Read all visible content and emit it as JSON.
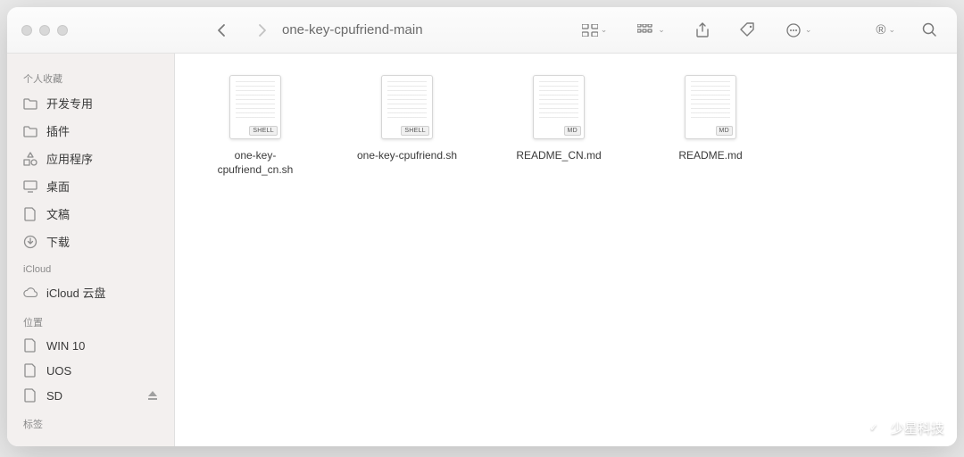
{
  "window": {
    "title": "one-key-cpufriend-main"
  },
  "sidebar": {
    "sections": [
      {
        "title": "个人收藏",
        "items": [
          {
            "icon": "folder",
            "label": "开发专用"
          },
          {
            "icon": "folder",
            "label": "插件"
          },
          {
            "icon": "apps",
            "label": "应用程序"
          },
          {
            "icon": "desktop",
            "label": "桌面"
          },
          {
            "icon": "doc",
            "label": "文稿"
          },
          {
            "icon": "download",
            "label": "下载"
          }
        ]
      },
      {
        "title": "iCloud",
        "items": [
          {
            "icon": "cloud",
            "label": "iCloud 云盘"
          }
        ]
      },
      {
        "title": "位置",
        "items": [
          {
            "icon": "page",
            "label": "WIN 10"
          },
          {
            "icon": "page",
            "label": "UOS"
          },
          {
            "icon": "page",
            "label": "SD",
            "eject": true
          }
        ]
      },
      {
        "title": "标签",
        "items": []
      }
    ]
  },
  "files": [
    {
      "name": "one-key-cpufriend_cn.sh",
      "badge": "SHELL"
    },
    {
      "name": "one-key-cpufriend.sh",
      "badge": "SHELL"
    },
    {
      "name": "README_CN.md",
      "badge": "MD"
    },
    {
      "name": "README.md",
      "badge": "MD"
    }
  ],
  "toolbar": {
    "registered": "®"
  },
  "watermark": {
    "text": "少星科技"
  }
}
